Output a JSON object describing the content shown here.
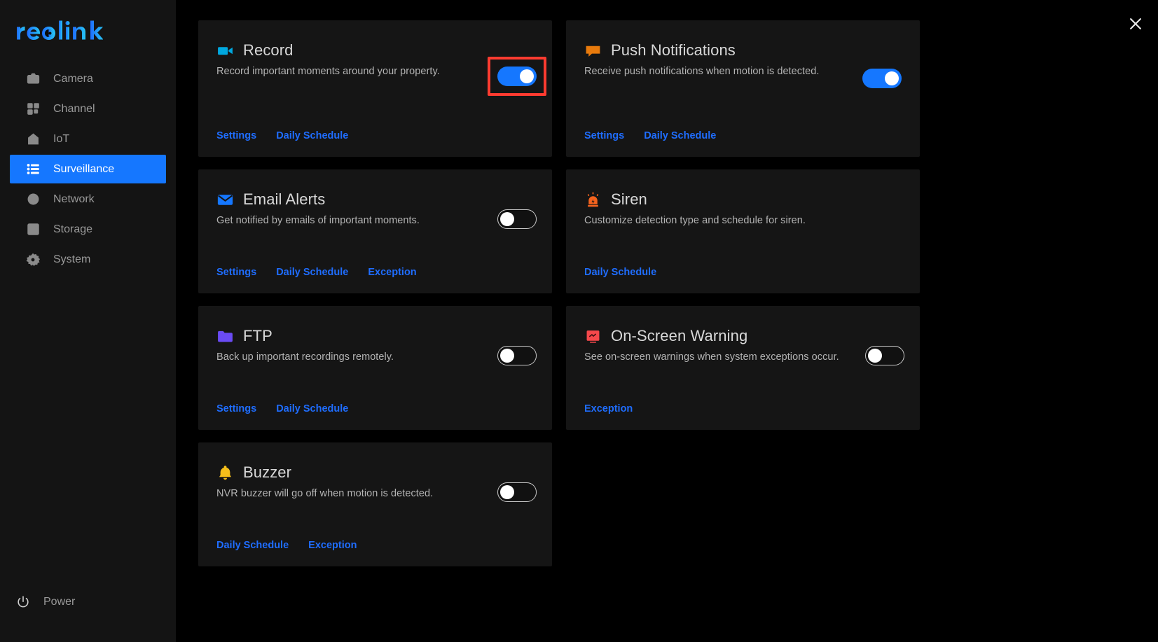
{
  "brand": {
    "name": "reolink"
  },
  "sidebar": {
    "items": [
      {
        "label": "Camera",
        "icon": "camera-icon",
        "active": false
      },
      {
        "label": "Channel",
        "icon": "grid-icon",
        "active": false
      },
      {
        "label": "IoT",
        "icon": "home-icon",
        "active": false
      },
      {
        "label": "Surveillance",
        "icon": "list-icon",
        "active": true
      },
      {
        "label": "Network",
        "icon": "globe-icon",
        "active": false
      },
      {
        "label": "Storage",
        "icon": "hard-drive-icon",
        "active": false
      },
      {
        "label": "System",
        "icon": "gear-icon",
        "active": false
      }
    ],
    "power": {
      "label": "Power",
      "icon": "power-icon"
    }
  },
  "window": {
    "close_icon": "close-icon"
  },
  "colors": {
    "accent_blue": "#1577ff",
    "link_blue": "#1f6dff",
    "highlight_red": "#ff3b30",
    "card_bg": "#151515",
    "sidebar_bg": "#141414",
    "page_bg": "#000000"
  },
  "cards": [
    {
      "id": "record",
      "title": "Record",
      "description": "Record important moments around your property.",
      "icon": "camcorder-icon",
      "icon_color": "#00a8e0",
      "toggle": {
        "present": true,
        "state": "on"
      },
      "highlighted": true,
      "links": [
        "Settings",
        "Daily Schedule"
      ]
    },
    {
      "id": "push-notifications",
      "title": "Push Notifications",
      "description": "Receive push notifications when motion is detected.",
      "icon": "speech-bubble-icon",
      "icon_color": "#e87a0c",
      "toggle": {
        "present": true,
        "state": "on"
      },
      "highlighted": false,
      "links": [
        "Settings",
        "Daily Schedule"
      ]
    },
    {
      "id": "email-alerts",
      "title": "Email Alerts",
      "description": "Get notified by emails of important moments.",
      "icon": "envelope-icon",
      "icon_color": "#1577ff",
      "toggle": {
        "present": true,
        "state": "off"
      },
      "highlighted": false,
      "links": [
        "Settings",
        "Daily Schedule",
        "Exception"
      ]
    },
    {
      "id": "siren",
      "title": "Siren",
      "description": "Customize detection type and schedule for siren.",
      "icon": "siren-icon",
      "icon_color": "#f4631e",
      "toggle": {
        "present": false,
        "state": "none"
      },
      "highlighted": false,
      "links": [
        "Daily Schedule"
      ]
    },
    {
      "id": "ftp",
      "title": "FTP",
      "description": "Back up important recordings remotely.",
      "icon": "folder-icon",
      "icon_color": "#6a4bf5",
      "toggle": {
        "present": true,
        "state": "off"
      },
      "highlighted": false,
      "links": [
        "Settings",
        "Daily Schedule"
      ]
    },
    {
      "id": "on-screen-warning",
      "title": "On-Screen Warning",
      "description": "See on-screen warnings when system exceptions occur.",
      "icon": "monitor-warning-icon",
      "icon_color": "#f5484b",
      "toggle": {
        "present": true,
        "state": "off"
      },
      "highlighted": false,
      "links": [
        "Exception"
      ]
    },
    {
      "id": "buzzer",
      "title": "Buzzer",
      "description": "NVR buzzer will go off when motion is detected.",
      "icon": "bell-icon",
      "icon_color": "#f5bf1a",
      "toggle": {
        "present": true,
        "state": "off"
      },
      "highlighted": false,
      "links": [
        "Daily Schedule",
        "Exception"
      ]
    }
  ]
}
